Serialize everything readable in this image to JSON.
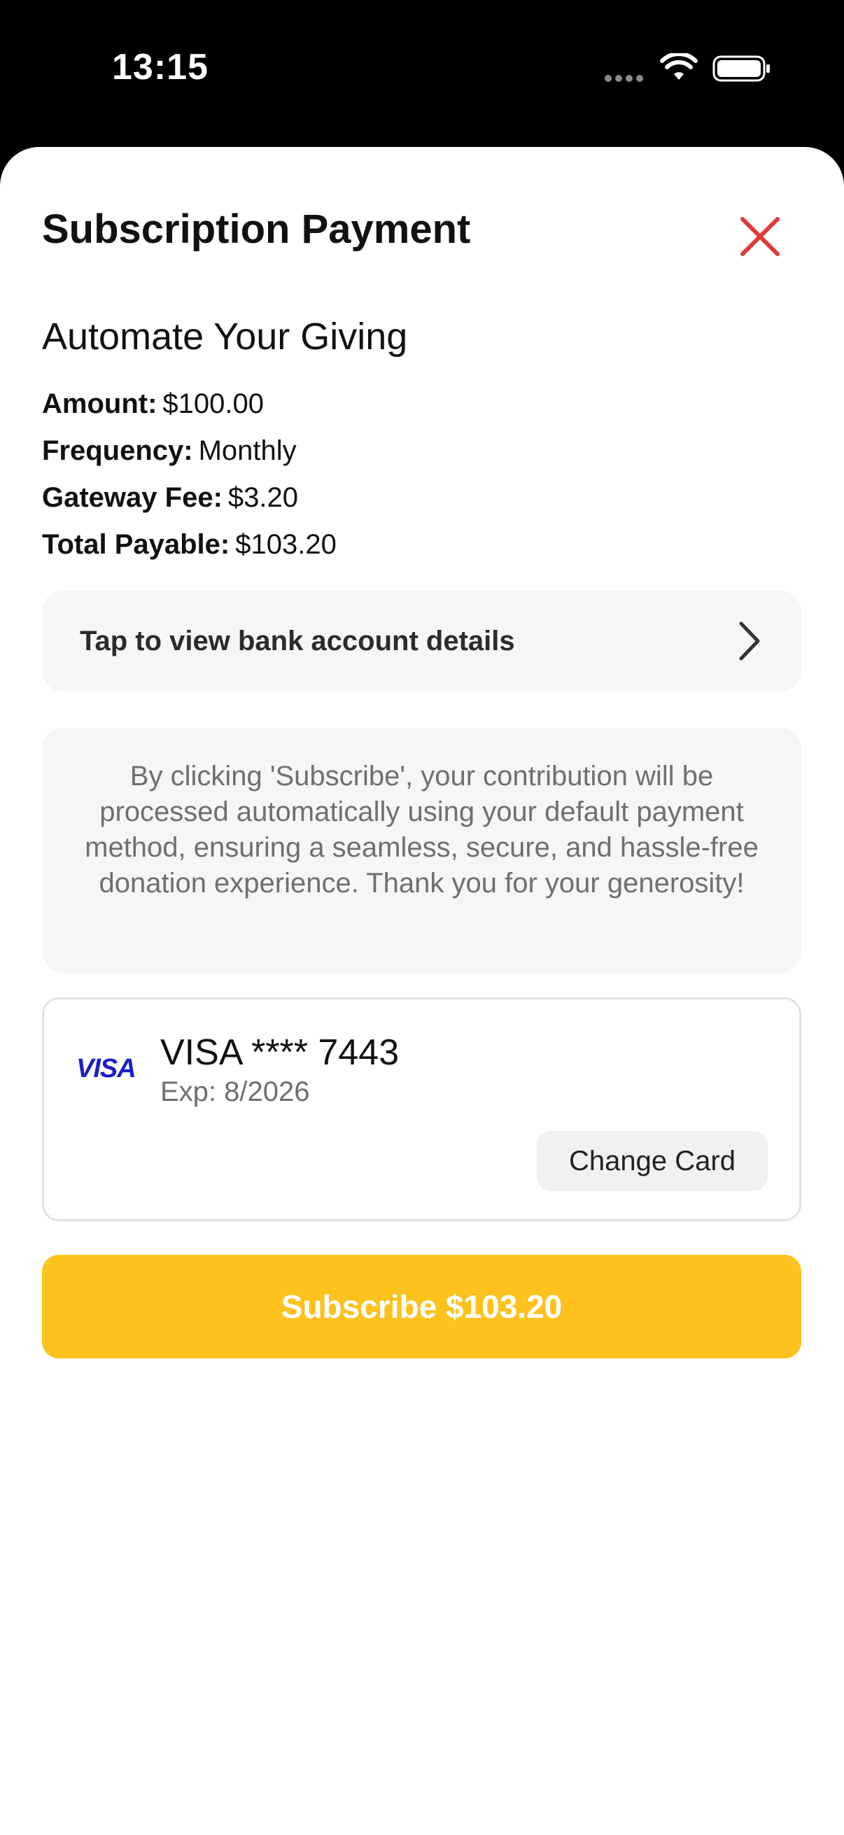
{
  "status_bar": {
    "time": "13:15"
  },
  "sheet": {
    "title": "Subscription Payment",
    "close_icon": "close-icon",
    "close_color": "#e03a3a"
  },
  "summary": {
    "heading": "Automate Your Giving",
    "rows": [
      {
        "label": "Amount:",
        "value": "$100.00"
      },
      {
        "label": "Frequency:",
        "value": "Monthly"
      },
      {
        "label": "Gateway Fee:",
        "value": "$3.20"
      },
      {
        "label": "Total Payable:",
        "value": "$103.20"
      }
    ]
  },
  "bank": {
    "label": "Tap to view bank account details",
    "icon": "chevron-right-icon"
  },
  "info": {
    "text": "By clicking 'Subscribe', your contribution will be processed automatically using your default payment method, ensuring a seamless, secure, and hassle-free donation experience. Thank you for your generosity!"
  },
  "card": {
    "brand_logo": "VISA",
    "number": "VISA **** 7443",
    "expiry": "Exp: 8/2026",
    "change_label": "Change Card"
  },
  "subscribe": {
    "label": "Subscribe $103.20",
    "color": "#fdc21e"
  }
}
